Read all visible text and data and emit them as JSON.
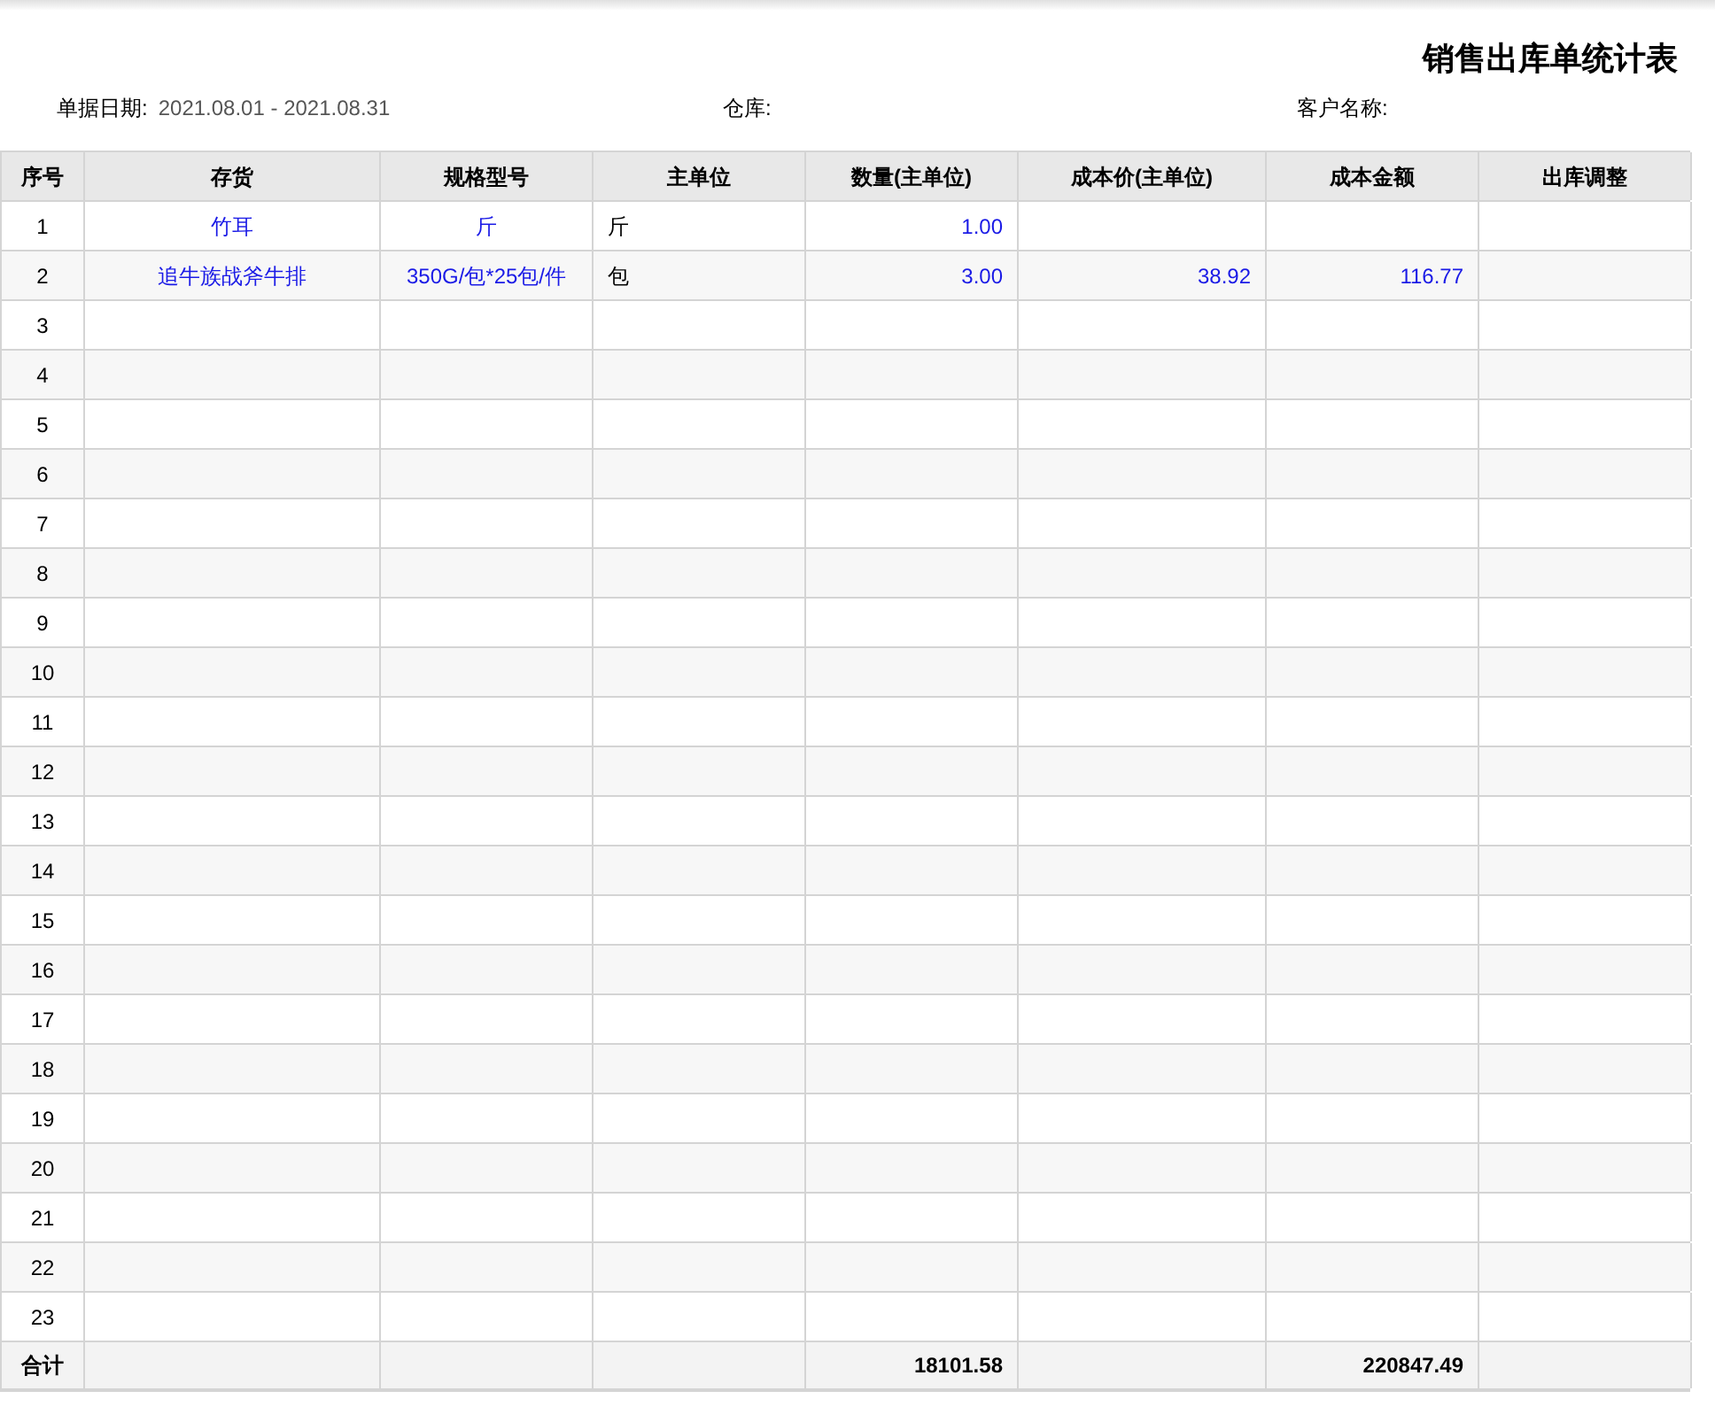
{
  "title": "销售出库单统计表",
  "filters": [
    {
      "label": "单据日期:",
      "value": "2021.08.01 - 2021.08.31"
    },
    {
      "label": "仓库:"
    },
    {
      "label": "客户名称:"
    }
  ],
  "table": {
    "columns": [
      "序号",
      "存货",
      "规格型号",
      "主单位",
      "数量(主单位)",
      "成本价(主单位)",
      "成本金额",
      "出库调整"
    ],
    "rows": [
      {
        "index": "1",
        "item": "竹耳",
        "spec": "斤",
        "unit": "斤",
        "qty": "1.00"
      },
      {
        "index": "2",
        "item": "追牛族战斧牛排",
        "spec": "350G/包*25包/件",
        "unit": "包",
        "qty": "3.00",
        "cost_price": "38.92",
        "cost_amount": "116.77"
      },
      {
        "index": "3"
      },
      {
        "index": "4"
      },
      {
        "index": "5"
      },
      {
        "index": "6"
      },
      {
        "index": "7"
      },
      {
        "index": "8"
      },
      {
        "index": "9"
      },
      {
        "index": "10"
      },
      {
        "index": "11"
      },
      {
        "index": "12"
      },
      {
        "index": "13"
      },
      {
        "index": "14"
      },
      {
        "index": "15"
      },
      {
        "index": "16"
      },
      {
        "index": "17"
      },
      {
        "index": "18"
      },
      {
        "index": "19"
      },
      {
        "index": "20"
      },
      {
        "index": "21"
      },
      {
        "index": "22"
      },
      {
        "index": "23"
      }
    ],
    "total": {
      "label": "合计",
      "qty": "18101.58",
      "cost_amount": "220847.49"
    }
  }
}
